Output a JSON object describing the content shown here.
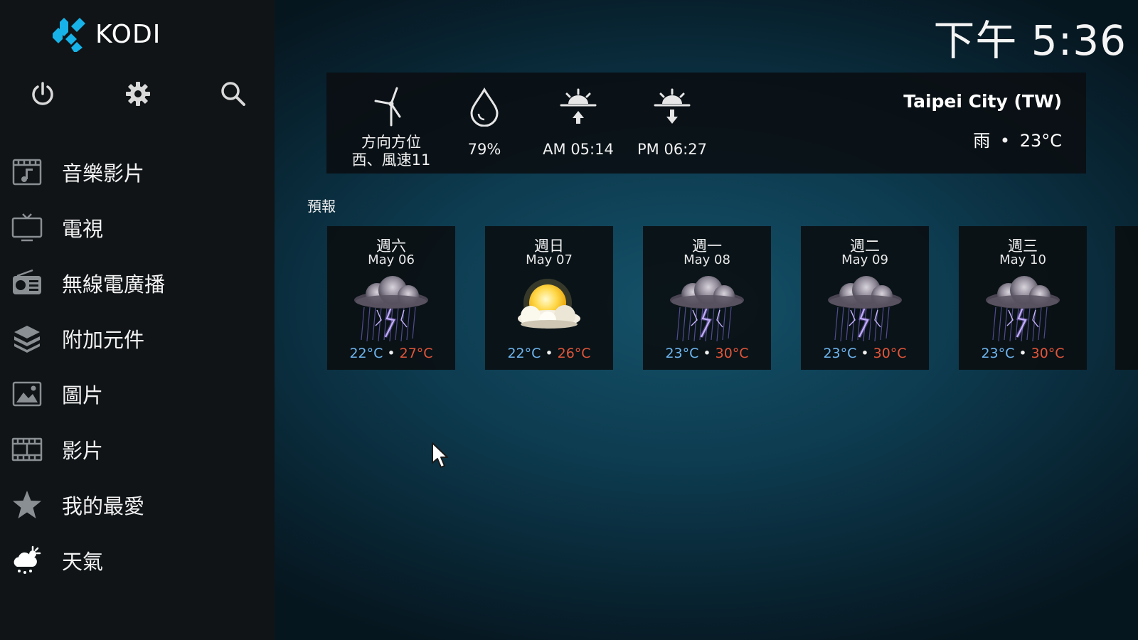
{
  "app": {
    "name": "KODI"
  },
  "clock": {
    "time": "下午 5:36"
  },
  "top_icons": [
    "power-icon",
    "settings-icon",
    "search-icon"
  ],
  "menu": {
    "items": [
      {
        "label": "音樂影片",
        "icon": "music-video-icon"
      },
      {
        "label": "電視",
        "icon": "tv-icon"
      },
      {
        "label": "無線電廣播",
        "icon": "radio-icon"
      },
      {
        "label": "附加元件",
        "icon": "addons-icon"
      },
      {
        "label": "圖片",
        "icon": "pictures-icon"
      },
      {
        "label": "影片",
        "icon": "videos-icon"
      },
      {
        "label": "我的最愛",
        "icon": "favourites-icon"
      },
      {
        "label": "天氣",
        "icon": "weather-icon"
      }
    ]
  },
  "current": {
    "location": "Taipei City (TW)",
    "condition": "雨",
    "separator": "•",
    "temperature": "23°C",
    "wind_line1": "方向方位",
    "wind_line2": "西、風速11",
    "humidity": "79%",
    "sunrise": "AM 05:14",
    "sunset": "PM 06:27"
  },
  "forecast": {
    "label": "預報",
    "days": [
      {
        "day": "週六",
        "date": "May 06",
        "low": "22°C",
        "high": "27°C",
        "icon": "thunderstorm-icon"
      },
      {
        "day": "週日",
        "date": "May 07",
        "low": "22°C",
        "high": "26°C",
        "icon": "partly-sunny-icon"
      },
      {
        "day": "週一",
        "date": "May 08",
        "low": "23°C",
        "high": "30°C",
        "icon": "thunderstorm-icon"
      },
      {
        "day": "週二",
        "date": "May 09",
        "low": "23°C",
        "high": "30°C",
        "icon": "thunderstorm-icon"
      },
      {
        "day": "週三",
        "date": "May 10",
        "low": "23°C",
        "high": "30°C",
        "icon": "thunderstorm-icon"
      }
    ]
  },
  "colors": {
    "low_temp": "#6fb6f0",
    "high_temp": "#e2553a",
    "kodi_blue": "#17b2e7"
  }
}
